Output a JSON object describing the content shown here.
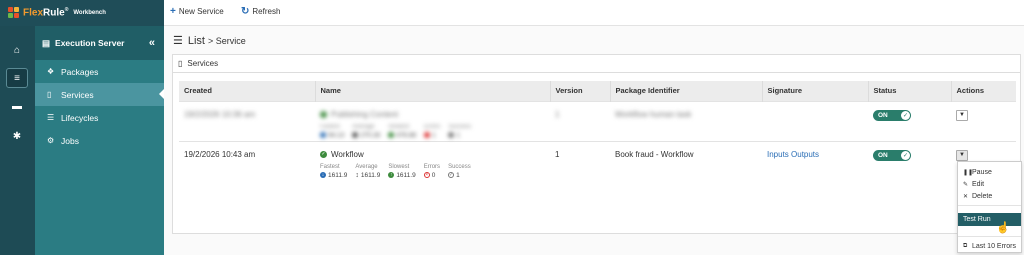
{
  "brand": {
    "name_a": "Flex",
    "name_b": "Rule",
    "reg": "®",
    "product": "Workbench"
  },
  "toolbar": {
    "new_service": "New Service",
    "refresh": "Refresh"
  },
  "rail": {
    "icons": [
      "home-icon",
      "server-icon",
      "archive-icon",
      "gear-icon"
    ]
  },
  "sidebar": {
    "title": "Execution Server",
    "items": [
      {
        "label": "Packages",
        "icon": "cubes-icon"
      },
      {
        "label": "Services",
        "icon": "bookmark-icon"
      },
      {
        "label": "Lifecycles",
        "icon": "list-icon"
      },
      {
        "label": "Jobs",
        "icon": "cogs-icon"
      }
    ]
  },
  "breadcrumb": {
    "main": "List",
    "sub": "> Service"
  },
  "panel": {
    "title": "Services"
  },
  "table": {
    "headers": [
      "Created",
      "Name",
      "Version",
      "Package Identifier",
      "Signature",
      "Status",
      "Actions"
    ],
    "rows": [
      {
        "created": "19/2/2026 10:36 am",
        "name": "Publishing Content",
        "version": "1",
        "package": "Workflow human task",
        "signature": "",
        "status": "ON",
        "stats": {
          "labels": [
            "Fastest",
            "Average",
            "Slowest",
            "Errors",
            "Success"
          ],
          "values": [
            "94.13",
            "270.28",
            "476.88",
            "1",
            "1"
          ]
        }
      },
      {
        "created": "19/2/2026 10:43 am",
        "name": "Workflow",
        "version": "1",
        "package": "Book fraud - Workflow",
        "signature": "Inputs Outputs",
        "status": "ON",
        "stats": {
          "labels": [
            "Fastest",
            "Average",
            "Slowest",
            "Errors",
            "Success"
          ],
          "values": [
            "1611.9",
            "1611.9",
            "1611.9",
            "0",
            "1"
          ]
        }
      }
    ]
  },
  "menu": {
    "items": [
      "Pause",
      "Edit",
      "Delete"
    ],
    "test_run": "Test Run",
    "last_errors": "Last 10 Errors"
  },
  "colors": {
    "sidebar": "#2b7c83",
    "rail": "#1e4b55",
    "toggle": "#2a7d6b",
    "accent": "#2a6db5",
    "brand_orange": "#f29a2e"
  }
}
